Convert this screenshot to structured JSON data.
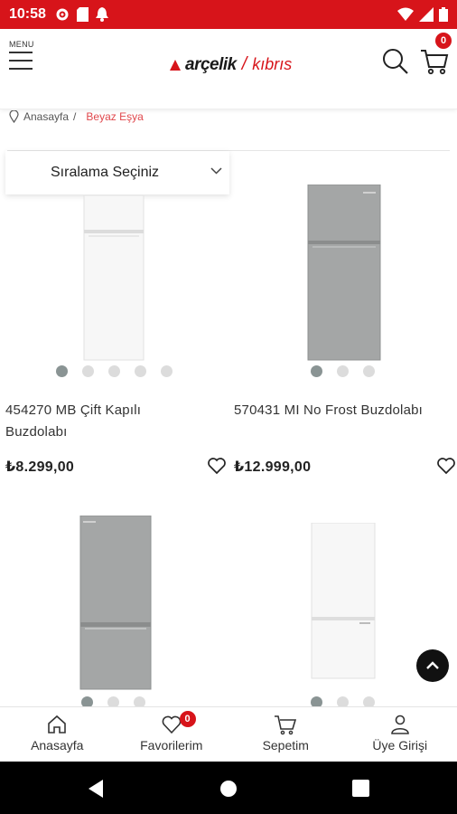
{
  "status_bar": {
    "time": "10:58"
  },
  "header": {
    "menu_label": "MENU",
    "brand": "arçelik",
    "brand_sub": "kıbrıs",
    "cart_count": "0"
  },
  "breadcrumb": {
    "home": "Anasayfa",
    "separator": "/",
    "current": "Beyaz Eşya"
  },
  "sort": {
    "label": "Sıralama Seçiniz"
  },
  "products": [
    {
      "name": "454270 MB Çift Kapılı Buzdolabı",
      "price": "₺8.299,00",
      "image_count": 5,
      "active_image": 1,
      "color": "white"
    },
    {
      "name": "570431 MI No Frost Buzdolabı",
      "price": "₺12.999,00",
      "image_count": 3,
      "active_image": 1,
      "color": "gray"
    },
    {
      "name": "",
      "price": "",
      "image_count": 3,
      "active_image": 1,
      "color": "gray"
    },
    {
      "name": "",
      "price": "",
      "image_count": 3,
      "active_image": 1,
      "color": "white"
    }
  ],
  "bottom_nav": [
    {
      "label": "Anasayfa",
      "icon": "home-icon"
    },
    {
      "label": "Favorilerim",
      "icon": "heart-icon",
      "badge": "0"
    },
    {
      "label": "Sepetim",
      "icon": "cart-icon"
    },
    {
      "label": "Üye Girişi",
      "icon": "user-icon"
    }
  ],
  "colors": {
    "brand_red": "#d7141a",
    "text": "#222222",
    "dot_active": "#8a9494"
  }
}
